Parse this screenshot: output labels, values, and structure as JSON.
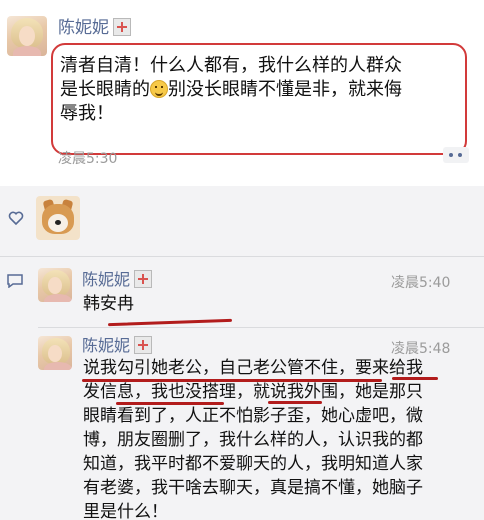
{
  "post": {
    "author": "陈妮妮",
    "text_line1": "清者自清！什么人都有，我什么样的人群众",
    "text_line2a": "是长眼睛的",
    "text_line2b": "别没长眼睛不懂是非，就来侮",
    "text_line3": "辱我！",
    "time": "凌晨5:30"
  },
  "comments": [
    {
      "author": "陈妮妮",
      "time": "凌晨5:40",
      "lines": [
        "韩安冉"
      ]
    },
    {
      "author": "陈妮妮",
      "time": "凌晨5:48",
      "lines": [
        "说我勾引她老公，自己老公管不住，要来给我",
        "发信息，我也没搭理，就说我外围，她是那只",
        "眼睛看到了，人正不怕影子歪，她心虚吧，微",
        "博，朋友圈删了，我什么样的人，认识我的都",
        "知道，我平时都不爱聊天的人，我明知道人家",
        "有老婆，我干啥去聊天，真是搞不懂，她脑子",
        "里是什么！"
      ]
    }
  ],
  "icons": {
    "like": "heart-outline-icon",
    "comment": "comment-bubble-icon",
    "more": "more-dots-icon",
    "badge": "red-cross-badge-icon",
    "emoji": "smile-emoji-icon"
  },
  "colors": {
    "name": "#576b95",
    "highlight_red": "#d23a3a",
    "underline_red": "#b21c1c",
    "interact_bg": "#f3f3f5"
  }
}
